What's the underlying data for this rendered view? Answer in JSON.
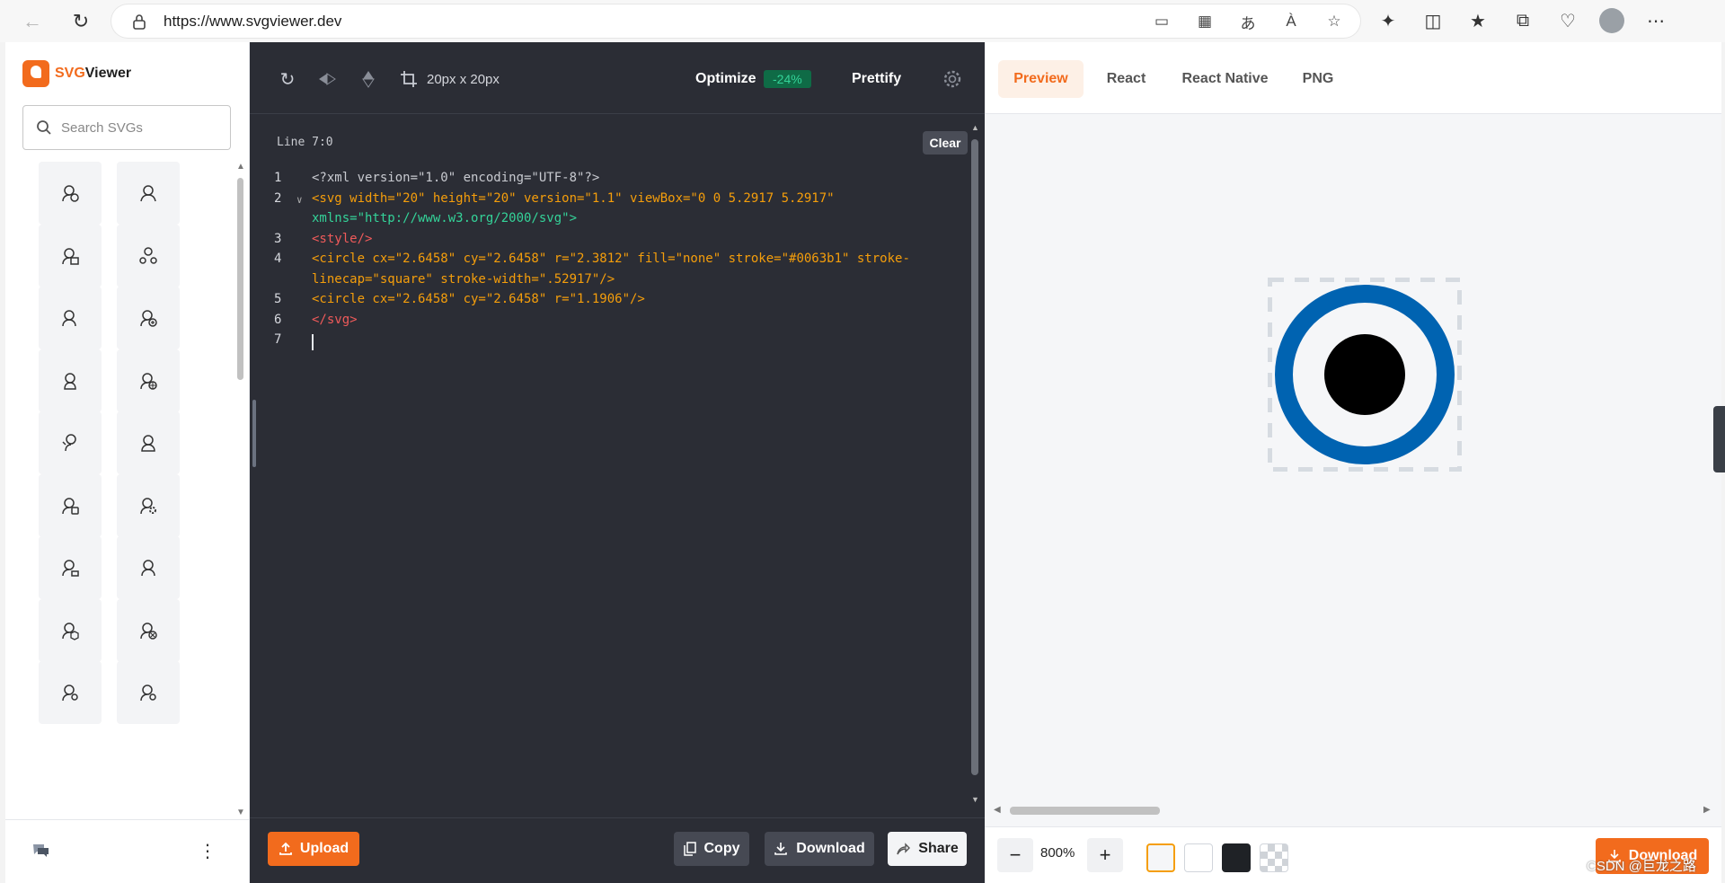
{
  "browser": {
    "url": "https://www.svgviewer.dev"
  },
  "sidebar": {
    "logo_svg": "SVG",
    "logo_rest": "Viewer",
    "search_placeholder": "Search SVGs"
  },
  "toolbar": {
    "size_label": "20px x 20px",
    "optimize_label": "Optimize",
    "optimize_badge": "-24%",
    "prettify_label": "Prettify"
  },
  "editor": {
    "line_info": "Line 7:0",
    "clear_label": "Clear",
    "lines": [
      {
        "n": "1",
        "text": "<?xml version=\"1.0\" encoding=\"UTF-8\"?>"
      },
      {
        "n": "2",
        "text": "<svg width=\"20\" height=\"20\" version=\"1.1\" viewBox=\"0 0 5.2917 5.2917\""
      },
      {
        "n": "",
        "text": "xmlns=\"http://www.w3.org/2000/svg\">"
      },
      {
        "n": "3",
        "text": " <style/>"
      },
      {
        "n": "4",
        "text": " <circle cx=\"2.6458\" cy=\"2.6458\" r=\"2.3812\" fill=\"none\" stroke=\"#0063b1\" stroke-"
      },
      {
        "n": "",
        "text": "linecap=\"square\" stroke-width=\".52917\"/>"
      },
      {
        "n": "5",
        "text": " <circle cx=\"2.6458\" cy=\"2.6458\" r=\"1.1906\"/>"
      },
      {
        "n": "6",
        "text": "</svg>"
      },
      {
        "n": "7",
        "text": ""
      }
    ]
  },
  "editor_footer": {
    "upload_label": "Upload",
    "copy_label": "Copy",
    "download_label": "Download",
    "share_label": "Share"
  },
  "preview": {
    "tabs": [
      "Preview",
      "React",
      "React Native",
      "PNG"
    ],
    "active_tab": "Preview",
    "zoom": "800%",
    "download_label": "Download",
    "svg_colors": {
      "stroke": "#0063b1",
      "fill": "#000000"
    }
  },
  "watermark": "CSDN @巨龙之路",
  "colors": {
    "accent": "#f26b1d",
    "editor_bg": "#2b2d35",
    "badge_bg": "#0f6b46"
  }
}
